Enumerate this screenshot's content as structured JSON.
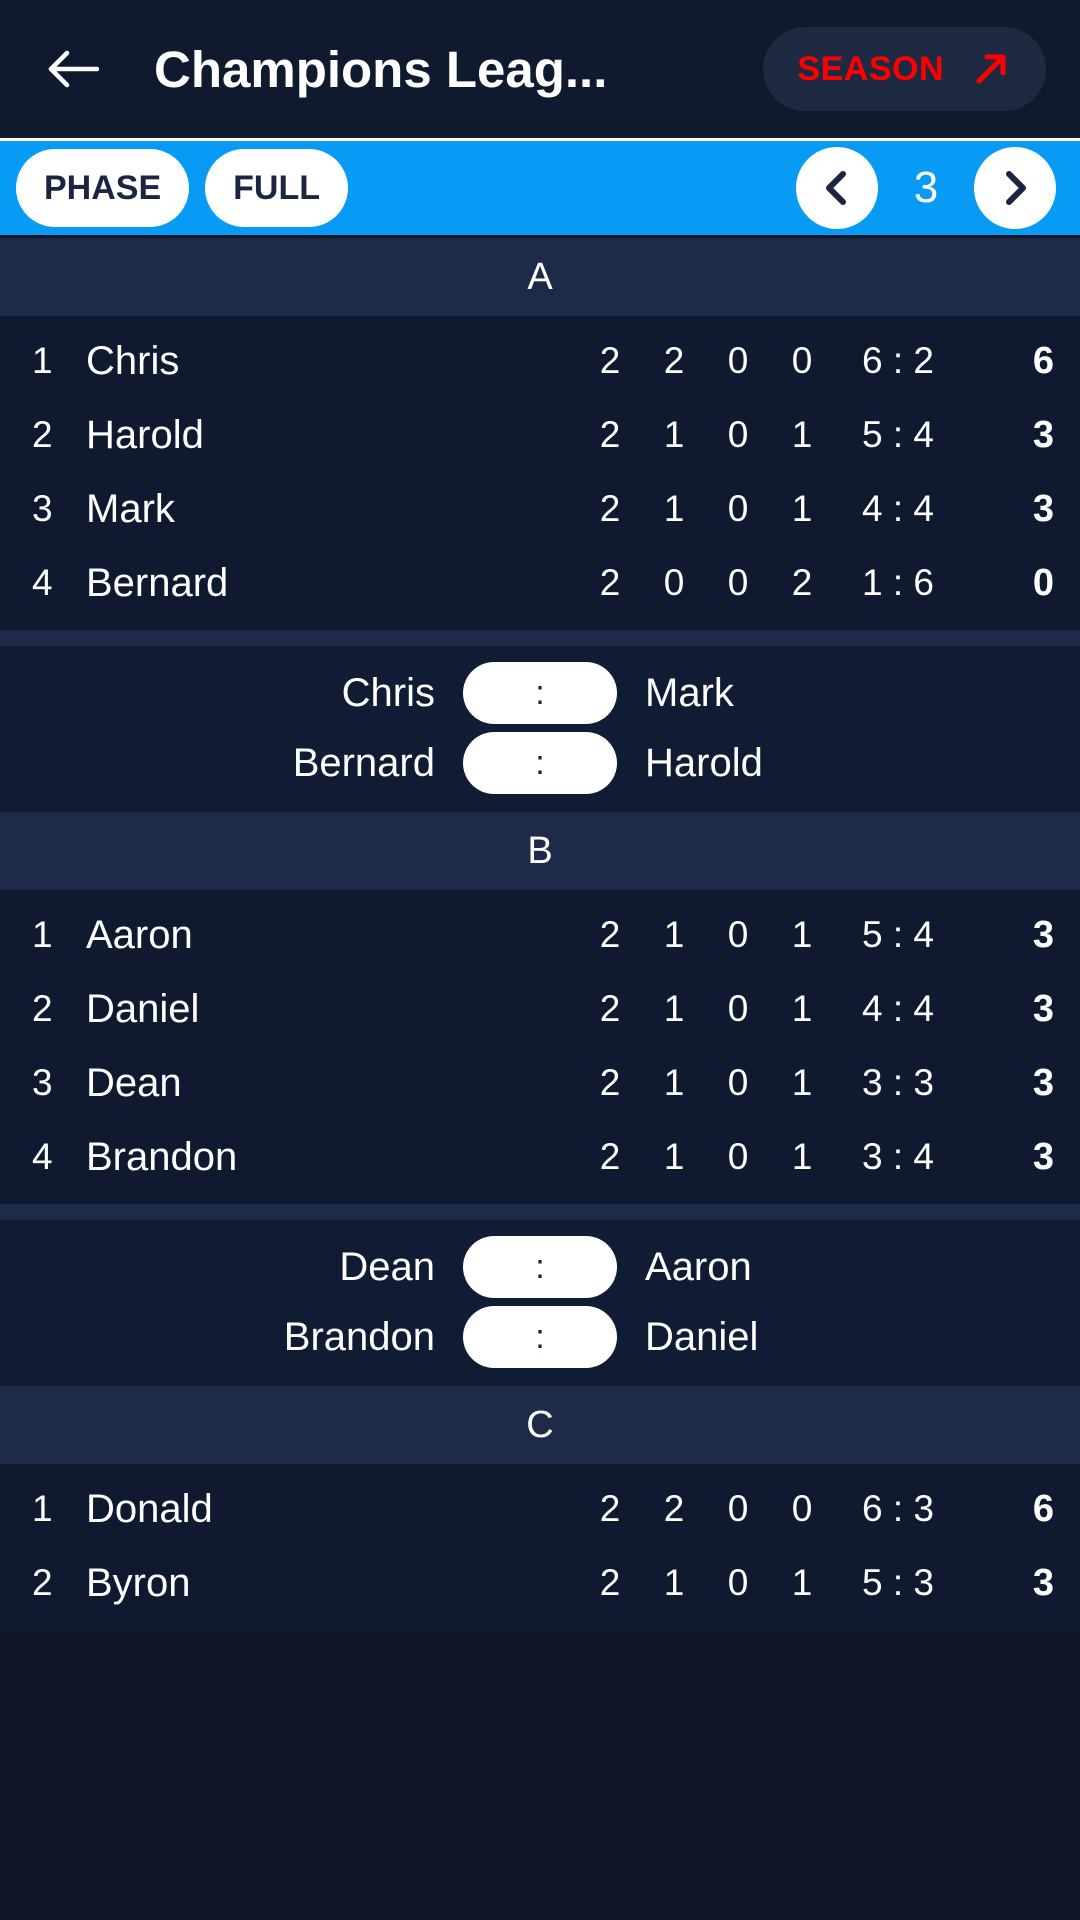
{
  "appbar": {
    "back_icon": "back-arrow-icon",
    "title": "Champions Leag...",
    "season_label": "SEASON",
    "season_icon": "arrow-up-right-icon"
  },
  "toolbar": {
    "phase_label": "PHASE",
    "full_label": "FULL",
    "prev_icon": "chevron-left-icon",
    "next_icon": "chevron-right-icon",
    "round_number": "3",
    "accent_color": "#079bf5"
  },
  "groups": [
    {
      "name": "A",
      "standings": [
        {
          "rank": "1",
          "team": "Chris",
          "played": "2",
          "won": "2",
          "drawn": "0",
          "lost": "0",
          "goals": "6 : 2",
          "points": "6"
        },
        {
          "rank": "2",
          "team": "Harold",
          "played": "2",
          "won": "1",
          "drawn": "0",
          "lost": "1",
          "goals": "5 : 4",
          "points": "3"
        },
        {
          "rank": "3",
          "team": "Mark",
          "played": "2",
          "won": "1",
          "drawn": "0",
          "lost": "1",
          "goals": "4 : 4",
          "points": "3"
        },
        {
          "rank": "4",
          "team": "Bernard",
          "played": "2",
          "won": "0",
          "drawn": "0",
          "lost": "2",
          "goals": "1 : 6",
          "points": "0"
        }
      ],
      "fixtures": [
        {
          "home": "Chris",
          "score": ":",
          "away": "Mark"
        },
        {
          "home": "Bernard",
          "score": ":",
          "away": "Harold"
        }
      ]
    },
    {
      "name": "B",
      "standings": [
        {
          "rank": "1",
          "team": "Aaron",
          "played": "2",
          "won": "1",
          "drawn": "0",
          "lost": "1",
          "goals": "5 : 4",
          "points": "3"
        },
        {
          "rank": "2",
          "team": "Daniel",
          "played": "2",
          "won": "1",
          "drawn": "0",
          "lost": "1",
          "goals": "4 : 4",
          "points": "3"
        },
        {
          "rank": "3",
          "team": "Dean",
          "played": "2",
          "won": "1",
          "drawn": "0",
          "lost": "1",
          "goals": "3 : 3",
          "points": "3"
        },
        {
          "rank": "4",
          "team": "Brandon",
          "played": "2",
          "won": "1",
          "drawn": "0",
          "lost": "1",
          "goals": "3 : 4",
          "points": "3"
        }
      ],
      "fixtures": [
        {
          "home": "Dean",
          "score": ":",
          "away": "Aaron"
        },
        {
          "home": "Brandon",
          "score": ":",
          "away": "Daniel"
        }
      ]
    },
    {
      "name": "C",
      "standings": [
        {
          "rank": "1",
          "team": "Donald",
          "played": "2",
          "won": "2",
          "drawn": "0",
          "lost": "0",
          "goals": "6 : 3",
          "points": "6"
        },
        {
          "rank": "2",
          "team": "Byron",
          "played": "2",
          "won": "1",
          "drawn": "0",
          "lost": "1",
          "goals": "5 : 3",
          "points": "3"
        }
      ],
      "fixtures": []
    }
  ]
}
